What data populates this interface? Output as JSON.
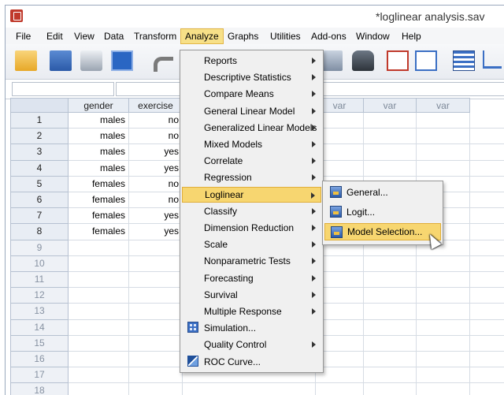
{
  "window": {
    "title": "*loglinear analysis.sav"
  },
  "menubar": [
    "File",
    "Edit",
    "View",
    "Data",
    "Transform",
    "Analyze",
    "Graphs",
    "Utilities",
    "Add-ons",
    "Window",
    "Help"
  ],
  "columns": [
    "gender",
    "exercise",
    "var",
    "var",
    "var",
    "var"
  ],
  "rows": [
    {
      "n": "1",
      "gender": "males",
      "exercise": "no"
    },
    {
      "n": "2",
      "gender": "males",
      "exercise": "no"
    },
    {
      "n": "3",
      "gender": "males",
      "exercise": "yes"
    },
    {
      "n": "4",
      "gender": "males",
      "exercise": "yes"
    },
    {
      "n": "5",
      "gender": "females",
      "exercise": "no"
    },
    {
      "n": "6",
      "gender": "females",
      "exercise": "no"
    },
    {
      "n": "7",
      "gender": "females",
      "exercise": "yes"
    },
    {
      "n": "8",
      "gender": "females",
      "exercise": "yes"
    },
    {
      "n": "9",
      "gender": "",
      "exercise": ""
    },
    {
      "n": "10",
      "gender": "",
      "exercise": ""
    },
    {
      "n": "11",
      "gender": "",
      "exercise": ""
    },
    {
      "n": "12",
      "gender": "",
      "exercise": ""
    },
    {
      "n": "13",
      "gender": "",
      "exercise": ""
    },
    {
      "n": "14",
      "gender": "",
      "exercise": ""
    },
    {
      "n": "15",
      "gender": "",
      "exercise": ""
    },
    {
      "n": "16",
      "gender": "",
      "exercise": ""
    },
    {
      "n": "17",
      "gender": "",
      "exercise": ""
    },
    {
      "n": "18",
      "gender": "",
      "exercise": ""
    }
  ],
  "analyze_menu": [
    {
      "label": "Reports",
      "submenu": true
    },
    {
      "label": "Descriptive Statistics",
      "submenu": true
    },
    {
      "label": "Compare Means",
      "submenu": true
    },
    {
      "label": "General Linear Model",
      "submenu": true
    },
    {
      "label": "Generalized Linear Models",
      "submenu": true
    },
    {
      "label": "Mixed Models",
      "submenu": true
    },
    {
      "label": "Correlate",
      "submenu": true
    },
    {
      "label": "Regression",
      "submenu": true
    },
    {
      "label": "Loglinear",
      "submenu": true,
      "active": true
    },
    {
      "label": "Classify",
      "submenu": true
    },
    {
      "label": "Dimension Reduction",
      "submenu": true
    },
    {
      "label": "Scale",
      "submenu": true
    },
    {
      "label": "Nonparametric Tests",
      "submenu": true
    },
    {
      "label": "Forecasting",
      "submenu": true
    },
    {
      "label": "Survival",
      "submenu": true
    },
    {
      "label": "Multiple Response",
      "submenu": true
    },
    {
      "label": "Simulation...",
      "submenu": false,
      "icon": "simulation-icon"
    },
    {
      "label": "Quality Control",
      "submenu": true
    },
    {
      "label": "ROC Curve...",
      "submenu": false,
      "icon": "roc-curve-icon"
    }
  ],
  "loglinear_submenu": [
    {
      "label": "General..."
    },
    {
      "label": "Logit..."
    },
    {
      "label": "Model Selection...",
      "active": true
    }
  ],
  "colors": {
    "highlight": "#f7d670",
    "menu_bg": "#f0f0f0",
    "header_bg": "#e8edf4"
  }
}
